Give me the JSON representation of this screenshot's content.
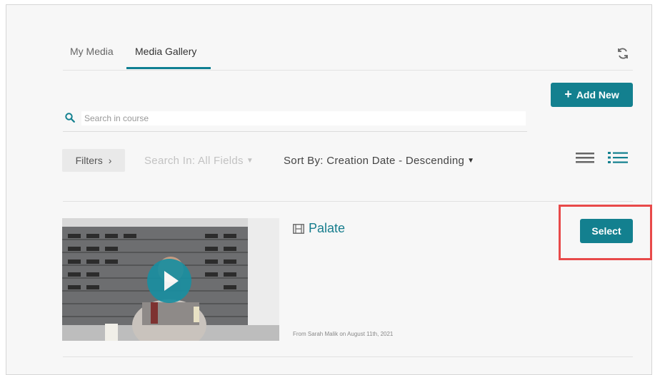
{
  "tabs": [
    {
      "label": "My Media",
      "active": false
    },
    {
      "label": "Media Gallery",
      "active": true
    }
  ],
  "toolbar": {
    "add_new_label": "Add New"
  },
  "search": {
    "placeholder": "Search in course",
    "value": ""
  },
  "filters": {
    "filters_label": "Filters",
    "search_in_label": "Search In: All Fields",
    "sort_by_label": "Sort By: Creation Date - Descending"
  },
  "media_items": [
    {
      "title": "Palate",
      "meta": "From Sarah Malik on August 11th, 2021",
      "action_label": "Select"
    }
  ],
  "icons": {
    "refresh": "refresh-icon",
    "search": "search-icon",
    "list_view": "list-view-icon",
    "detail_view": "detail-view-icon",
    "media_type": "film-icon",
    "play": "play-icon"
  },
  "colors": {
    "accent": "#13808f",
    "link": "#177d8d",
    "highlight": "#e84a4a"
  }
}
